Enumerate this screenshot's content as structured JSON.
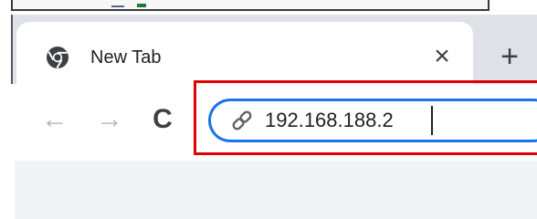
{
  "tab": {
    "title": "New Tab",
    "close_glyph": "×",
    "new_tab_glyph": "+",
    "favicon": "chrome-icon"
  },
  "toolbar": {
    "back_glyph": "←",
    "forward_glyph": "→",
    "reload_glyph": "C"
  },
  "omnibox": {
    "value": "192.168.188.2",
    "icon": "link-icon",
    "focus_color": "#1a73e8"
  },
  "highlight": {
    "color": "#e00000"
  }
}
